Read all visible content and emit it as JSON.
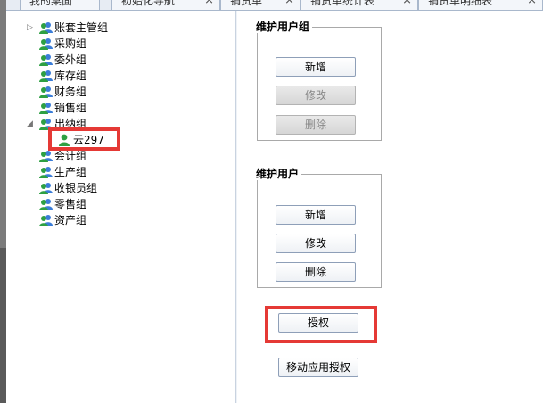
{
  "tabs": [
    {
      "label": "我的桌面",
      "closable": false
    },
    {
      "label": "初始化导航",
      "closable": true
    },
    {
      "label": "销货单",
      "closable": true
    },
    {
      "label": "销货单统计表",
      "closable": true
    },
    {
      "label": "销货单明细表",
      "closable": true
    }
  ],
  "tree": {
    "groups": [
      {
        "label": "账套主管组",
        "expanded": false
      },
      {
        "label": "采购组"
      },
      {
        "label": "委外组"
      },
      {
        "label": "库存组"
      },
      {
        "label": "财务组"
      },
      {
        "label": "销售组"
      },
      {
        "label": "出纳组",
        "expanded": true,
        "children": [
          {
            "label": "云297",
            "selected": true
          }
        ]
      },
      {
        "label": "会计组"
      },
      {
        "label": "生产组"
      },
      {
        "label": "收银员组"
      },
      {
        "label": "零售组"
      },
      {
        "label": "资产组"
      }
    ]
  },
  "maintain_group": {
    "legend": "维护用户组",
    "add_label": "新增",
    "edit_label": "修改",
    "delete_label": "删除"
  },
  "maintain_user": {
    "legend": "维护用户",
    "add_label": "新增",
    "edit_label": "修改",
    "delete_label": "删除"
  },
  "authorize_label": "授权",
  "mobile_authorize_label": "移动应用授权",
  "colors": {
    "highlight": "#e53935",
    "user_icon_blue": "#3b7dd8",
    "user_icon_green": "#2ea043"
  }
}
